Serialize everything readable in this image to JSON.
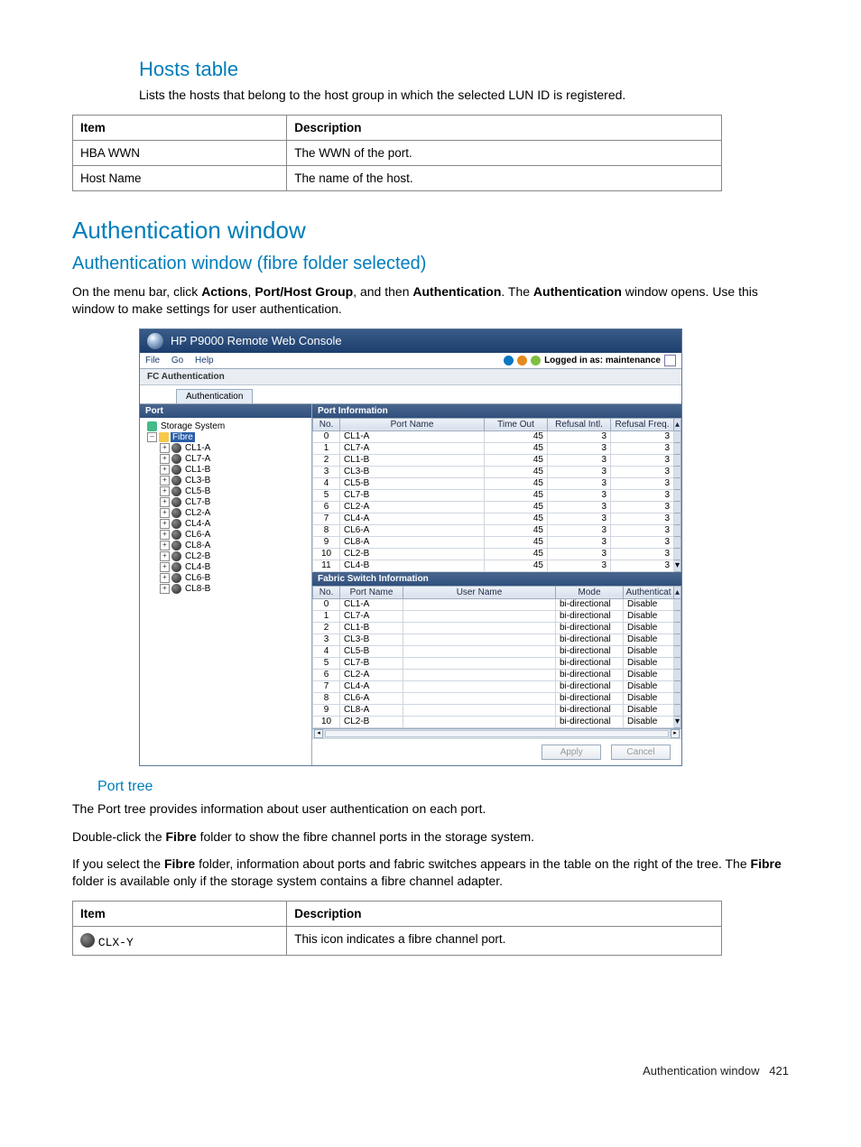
{
  "hosts_section": {
    "title": "Hosts table",
    "intro": "Lists the hosts that belong to the host group in which the selected LUN ID is registered.",
    "headers": [
      "Item",
      "Description"
    ],
    "rows": [
      {
        "item": "HBA WWN",
        "desc": "The WWN of the port."
      },
      {
        "item": "Host Name",
        "desc": "The name of the host."
      }
    ]
  },
  "auth_section": {
    "main_title": "Authentication window",
    "sub_title": "Authentication window (fibre folder selected)",
    "intro_pre": "On the menu bar, click ",
    "intro_b1": "Actions",
    "intro_mid1": ", ",
    "intro_b2": "Port/Host Group",
    "intro_mid2": ", and then ",
    "intro_b3": "Authentication",
    "intro_mid3": ". The ",
    "intro_b4": "Authentication",
    "intro_post": " window opens. Use this window to make settings for user authentication."
  },
  "screenshot": {
    "window_title": "HP P9000 Remote Web Console",
    "menus": [
      "File",
      "Go",
      "Help"
    ],
    "login_label": "Logged in as: maintenance",
    "subbar_label": "FC Authentication",
    "tab_label": "Authentication",
    "left_header": "Port",
    "tree_root": "Storage System",
    "tree_folder": "Fibre",
    "tree_ports": [
      "CL1-A",
      "CL7-A",
      "CL1-B",
      "CL3-B",
      "CL5-B",
      "CL7-B",
      "CL2-A",
      "CL4-A",
      "CL6-A",
      "CL8-A",
      "CL2-B",
      "CL4-B",
      "CL6-B",
      "CL8-B"
    ],
    "port_info_header": "Port Information",
    "port_cols": [
      "No.",
      "Port Name",
      "Time Out",
      "Refusal Intl.",
      "Refusal Freq."
    ],
    "port_rows": [
      {
        "no": "0",
        "name": "CL1-A",
        "timeout": "45",
        "intl": "3",
        "freq": "3"
      },
      {
        "no": "1",
        "name": "CL7-A",
        "timeout": "45",
        "intl": "3",
        "freq": "3"
      },
      {
        "no": "2",
        "name": "CL1-B",
        "timeout": "45",
        "intl": "3",
        "freq": "3"
      },
      {
        "no": "3",
        "name": "CL3-B",
        "timeout": "45",
        "intl": "3",
        "freq": "3"
      },
      {
        "no": "4",
        "name": "CL5-B",
        "timeout": "45",
        "intl": "3",
        "freq": "3"
      },
      {
        "no": "5",
        "name": "CL7-B",
        "timeout": "45",
        "intl": "3",
        "freq": "3"
      },
      {
        "no": "6",
        "name": "CL2-A",
        "timeout": "45",
        "intl": "3",
        "freq": "3"
      },
      {
        "no": "7",
        "name": "CL4-A",
        "timeout": "45",
        "intl": "3",
        "freq": "3"
      },
      {
        "no": "8",
        "name": "CL6-A",
        "timeout": "45",
        "intl": "3",
        "freq": "3"
      },
      {
        "no": "9",
        "name": "CL8-A",
        "timeout": "45",
        "intl": "3",
        "freq": "3"
      },
      {
        "no": "10",
        "name": "CL2-B",
        "timeout": "45",
        "intl": "3",
        "freq": "3"
      },
      {
        "no": "11",
        "name": "CL4-B",
        "timeout": "45",
        "intl": "3",
        "freq": "3"
      }
    ],
    "fabric_header": "Fabric Switch Information",
    "fabric_cols": [
      "No.",
      "Port Name",
      "User Name",
      "Mode",
      "Authenticat"
    ],
    "fabric_rows": [
      {
        "no": "0",
        "name": "CL1-A",
        "user": "",
        "mode": "bi-directional",
        "auth": "Disable"
      },
      {
        "no": "1",
        "name": "CL7-A",
        "user": "",
        "mode": "bi-directional",
        "auth": "Disable"
      },
      {
        "no": "2",
        "name": "CL1-B",
        "user": "",
        "mode": "bi-directional",
        "auth": "Disable"
      },
      {
        "no": "3",
        "name": "CL3-B",
        "user": "",
        "mode": "bi-directional",
        "auth": "Disable"
      },
      {
        "no": "4",
        "name": "CL5-B",
        "user": "",
        "mode": "bi-directional",
        "auth": "Disable"
      },
      {
        "no": "5",
        "name": "CL7-B",
        "user": "",
        "mode": "bi-directional",
        "auth": "Disable"
      },
      {
        "no": "6",
        "name": "CL2-A",
        "user": "",
        "mode": "bi-directional",
        "auth": "Disable"
      },
      {
        "no": "7",
        "name": "CL4-A",
        "user": "",
        "mode": "bi-directional",
        "auth": "Disable"
      },
      {
        "no": "8",
        "name": "CL6-A",
        "user": "",
        "mode": "bi-directional",
        "auth": "Disable"
      },
      {
        "no": "9",
        "name": "CL8-A",
        "user": "",
        "mode": "bi-directional",
        "auth": "Disable"
      },
      {
        "no": "10",
        "name": "CL2-B",
        "user": "",
        "mode": "bi-directional",
        "auth": "Disable"
      }
    ],
    "apply_btn": "Apply",
    "cancel_btn": "Cancel"
  },
  "porttree": {
    "title": "Port tree",
    "p1": "The Port tree provides information about user authentication on each port.",
    "p2_pre": "Double-click the ",
    "p2_b": "Fibre",
    "p2_post": " folder to show the fibre channel ports in the storage system.",
    "p3_pre": "If you select the ",
    "p3_b1": "Fibre",
    "p3_mid": " folder, information about ports and fabric switches appears in the table on the right of the tree. The ",
    "p3_b2": "Fibre",
    "p3_post": " folder is available only if the storage system contains a fibre channel adapter.",
    "headers": [
      "Item",
      "Description"
    ],
    "row_item_label": "CLX-Y",
    "row_desc": "This icon indicates a fibre channel port."
  },
  "footer": {
    "text": "Authentication window",
    "page": "421"
  }
}
